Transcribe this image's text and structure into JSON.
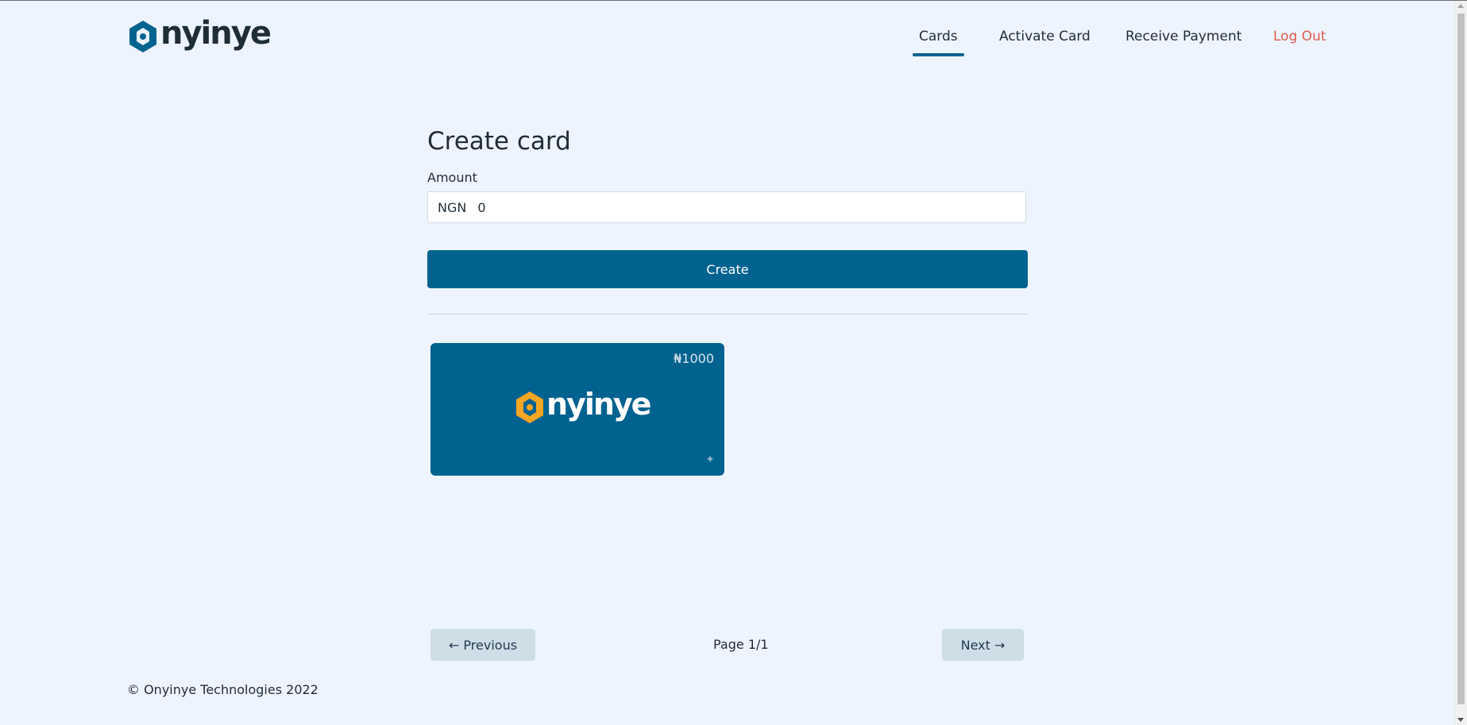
{
  "header": {
    "logo_text": "nyinye",
    "nav": [
      {
        "label": "Cards",
        "active": true
      },
      {
        "label": "Activate Card",
        "active": false
      },
      {
        "label": "Receive Payment",
        "active": false
      },
      {
        "label": "Log Out",
        "active": false
      }
    ]
  },
  "main": {
    "title": "Create card",
    "amount_label": "Amount",
    "currency_prefix": "NGN",
    "amount_value": "0",
    "create_button": "Create"
  },
  "cards": [
    {
      "amount": "₦1000",
      "logo_text": "nyinye"
    }
  ],
  "pagination": {
    "previous_label": "← Previous",
    "page_info": "Page 1/1",
    "next_label": "Next →"
  },
  "footer": {
    "copyright": "© Onyinye Technologies 2022"
  },
  "colors": {
    "background": "#edf4fe",
    "primary": "#00628f",
    "logout": "#e05a4f",
    "card_logo_accent": "#f5a623"
  }
}
